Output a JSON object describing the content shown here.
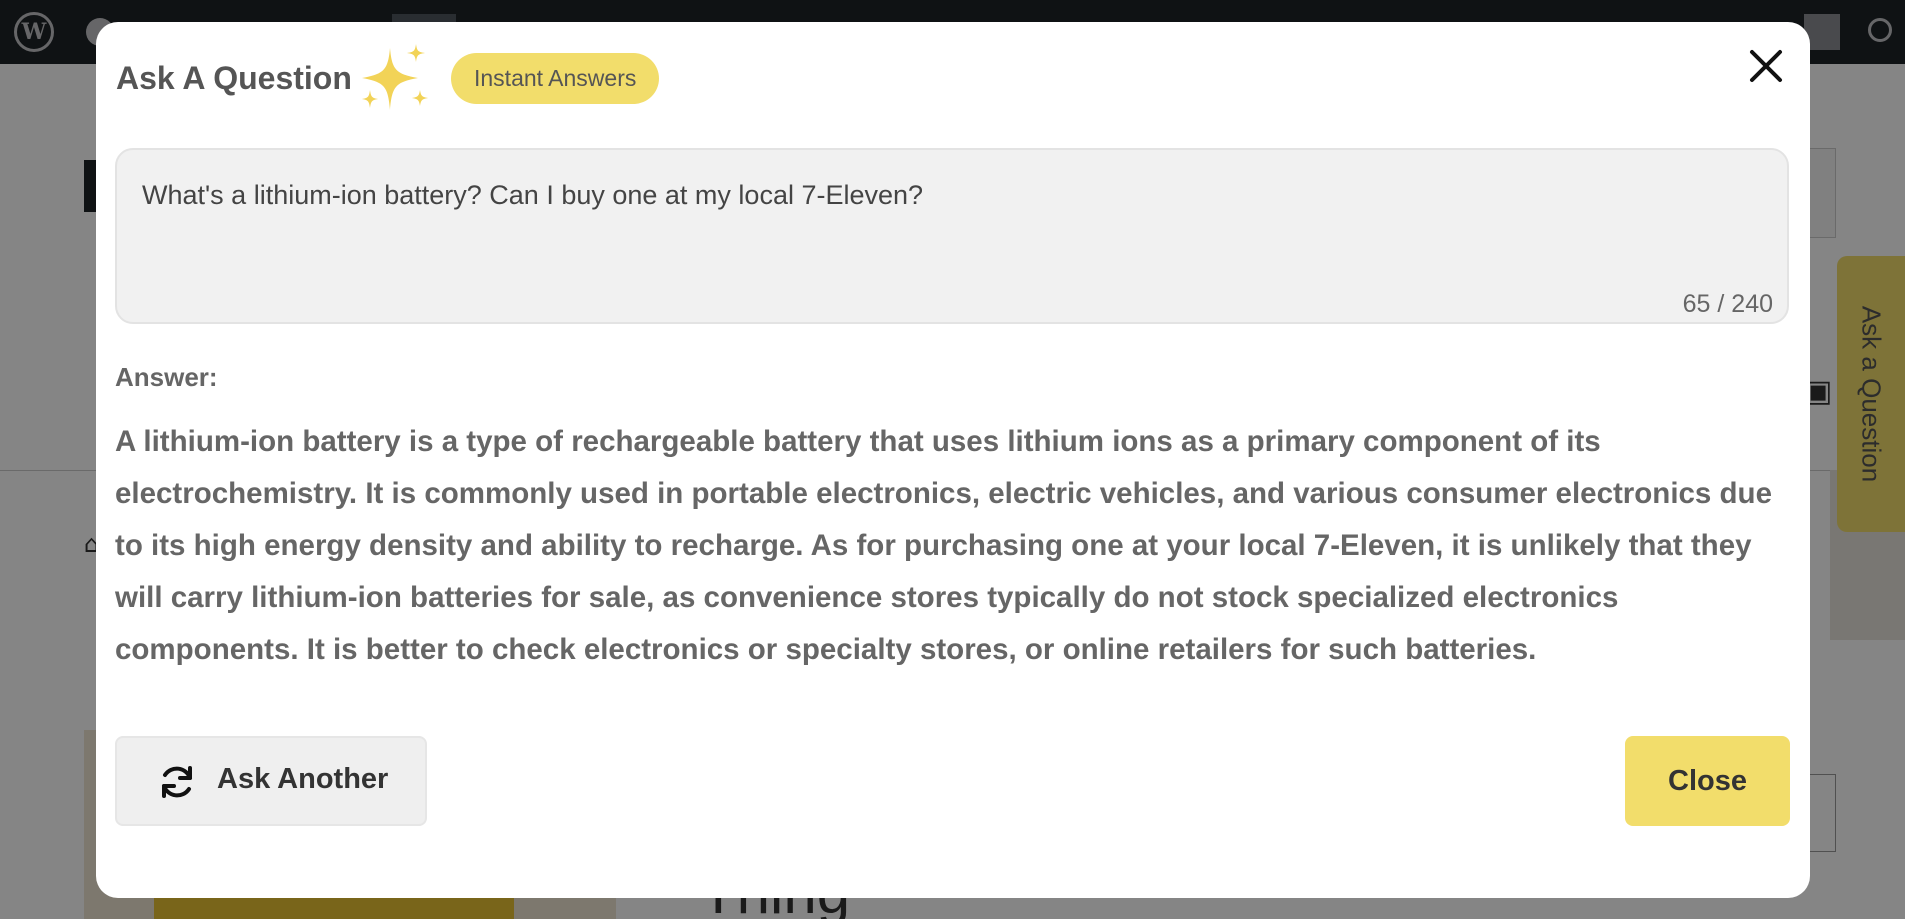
{
  "background": {
    "ask_tab_label": "Ask a Question",
    "heading_fragment": "Thing"
  },
  "modal": {
    "title": "Ask A Question",
    "badge": "Instant Answers",
    "question": {
      "value": "What's a lithium-ion battery? Can I buy one at my local 7-Eleven?",
      "char_count": "65 / 240"
    },
    "answer_label": "Answer:",
    "answer_text": "A lithium-ion battery is a type of rechargeable battery that uses lithium ions as a primary component of its electrochemistry. It is commonly used in portable electronics, electric vehicles, and various consumer electronics due to its high energy density and ability to recharge. As for purchasing one at your local 7-Eleven, it is unlikely that they will carry lithium-ion batteries for sale, as convenience stores typically do not stock specialized electronics components. It is better to check electronics or specialty stores, or online retailers for such batteries.",
    "buttons": {
      "ask_another": "Ask Another",
      "close": "Close"
    }
  },
  "icons": {
    "sparkle": "sparkle-icon",
    "close": "close-icon",
    "refresh": "refresh-icon"
  },
  "colors": {
    "accent_yellow": "#f2dd6b",
    "overlay": "#000000",
    "text_gray": "#666666",
    "admin_bar": "#1d2327"
  }
}
